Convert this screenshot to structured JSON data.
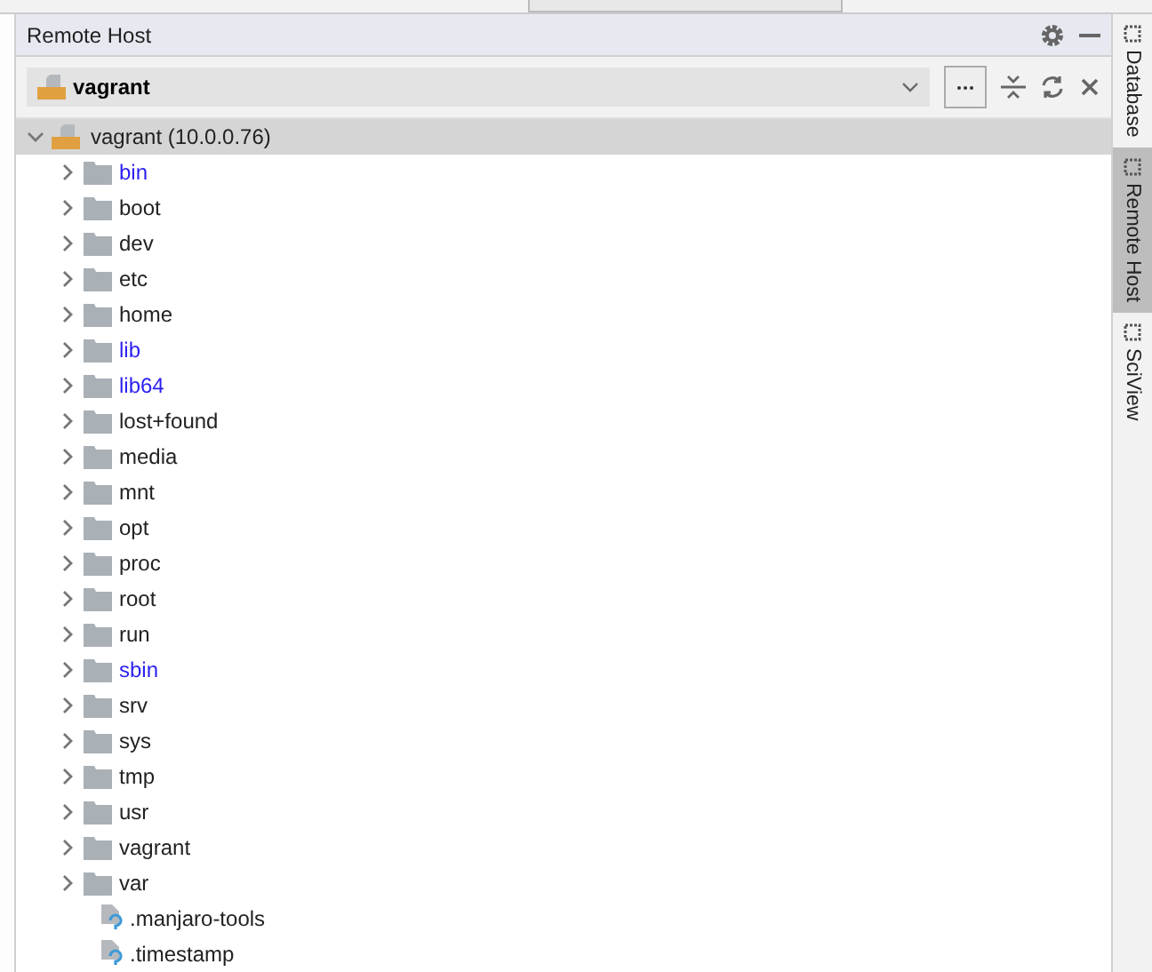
{
  "panel": {
    "title": "Remote Host"
  },
  "connection": {
    "value": "vagrant"
  },
  "tree": {
    "label": "vagrant (10.0.0.76)",
    "expanded": true,
    "children": [
      {
        "label": "bin",
        "kind": "link"
      },
      {
        "label": "boot",
        "kind": "dir"
      },
      {
        "label": "dev",
        "kind": "dir"
      },
      {
        "label": "etc",
        "kind": "dir"
      },
      {
        "label": "home",
        "kind": "dir"
      },
      {
        "label": "lib",
        "kind": "link"
      },
      {
        "label": "lib64",
        "kind": "link"
      },
      {
        "label": "lost+found",
        "kind": "dir"
      },
      {
        "label": "media",
        "kind": "dir"
      },
      {
        "label": "mnt",
        "kind": "dir"
      },
      {
        "label": "opt",
        "kind": "dir"
      },
      {
        "label": "proc",
        "kind": "dir"
      },
      {
        "label": "root",
        "kind": "dir"
      },
      {
        "label": "run",
        "kind": "dir"
      },
      {
        "label": "sbin",
        "kind": "link"
      },
      {
        "label": "srv",
        "kind": "dir"
      },
      {
        "label": "sys",
        "kind": "dir"
      },
      {
        "label": "tmp",
        "kind": "dir"
      },
      {
        "label": "usr",
        "kind": "dir"
      },
      {
        "label": "vagrant",
        "kind": "dir"
      },
      {
        "label": "var",
        "kind": "dir"
      },
      {
        "label": ".manjaro-tools",
        "kind": "file"
      },
      {
        "label": ".timestamp",
        "kind": "file"
      }
    ]
  },
  "side_tabs": [
    {
      "label": "Database",
      "selected": false
    },
    {
      "label": "Remote Host",
      "selected": true
    },
    {
      "label": "SciView",
      "selected": false
    }
  ]
}
